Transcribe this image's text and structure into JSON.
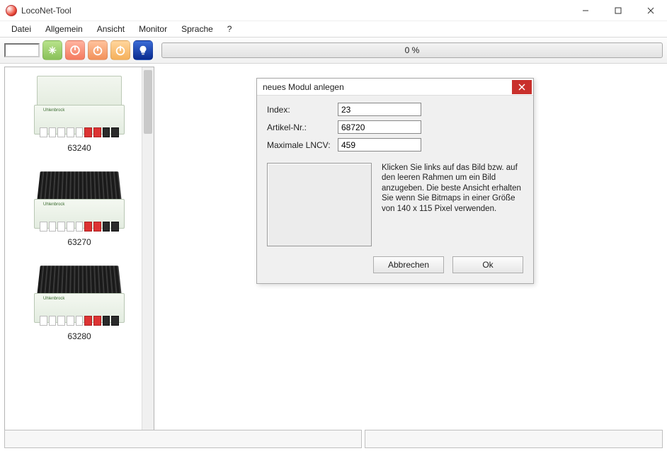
{
  "window": {
    "title": "LocoNet-Tool"
  },
  "menu": {
    "file": "Datei",
    "general": "Allgemein",
    "view": "Ansicht",
    "monitor": "Monitor",
    "language": "Sprache",
    "help": "?"
  },
  "toolbar": {
    "progress_text": "0 %"
  },
  "sidebar": {
    "items": [
      {
        "id": "63240",
        "label": "63240",
        "has_heatsink": false
      },
      {
        "id": "63270",
        "label": "63270",
        "has_heatsink": true
      },
      {
        "id": "63280",
        "label": "63280",
        "has_heatsink": true
      }
    ]
  },
  "dialog": {
    "title": "neues Modul anlegen",
    "labels": {
      "index": "Index:",
      "article": "Artikel-Nr.:",
      "max_lncv": "Maximale LNCV:"
    },
    "values": {
      "index": "23",
      "article": "68720",
      "max_lncv": "459"
    },
    "help_text": "Klicken Sie links auf das Bild bzw. auf den leeren Rahmen um ein Bild anzugeben. Die beste Ansicht erhalten Sie wenn Sie Bitmaps in einer Größe von 140 x 115 Pixel verwenden.",
    "buttons": {
      "cancel": "Abbrechen",
      "ok": "Ok"
    }
  }
}
